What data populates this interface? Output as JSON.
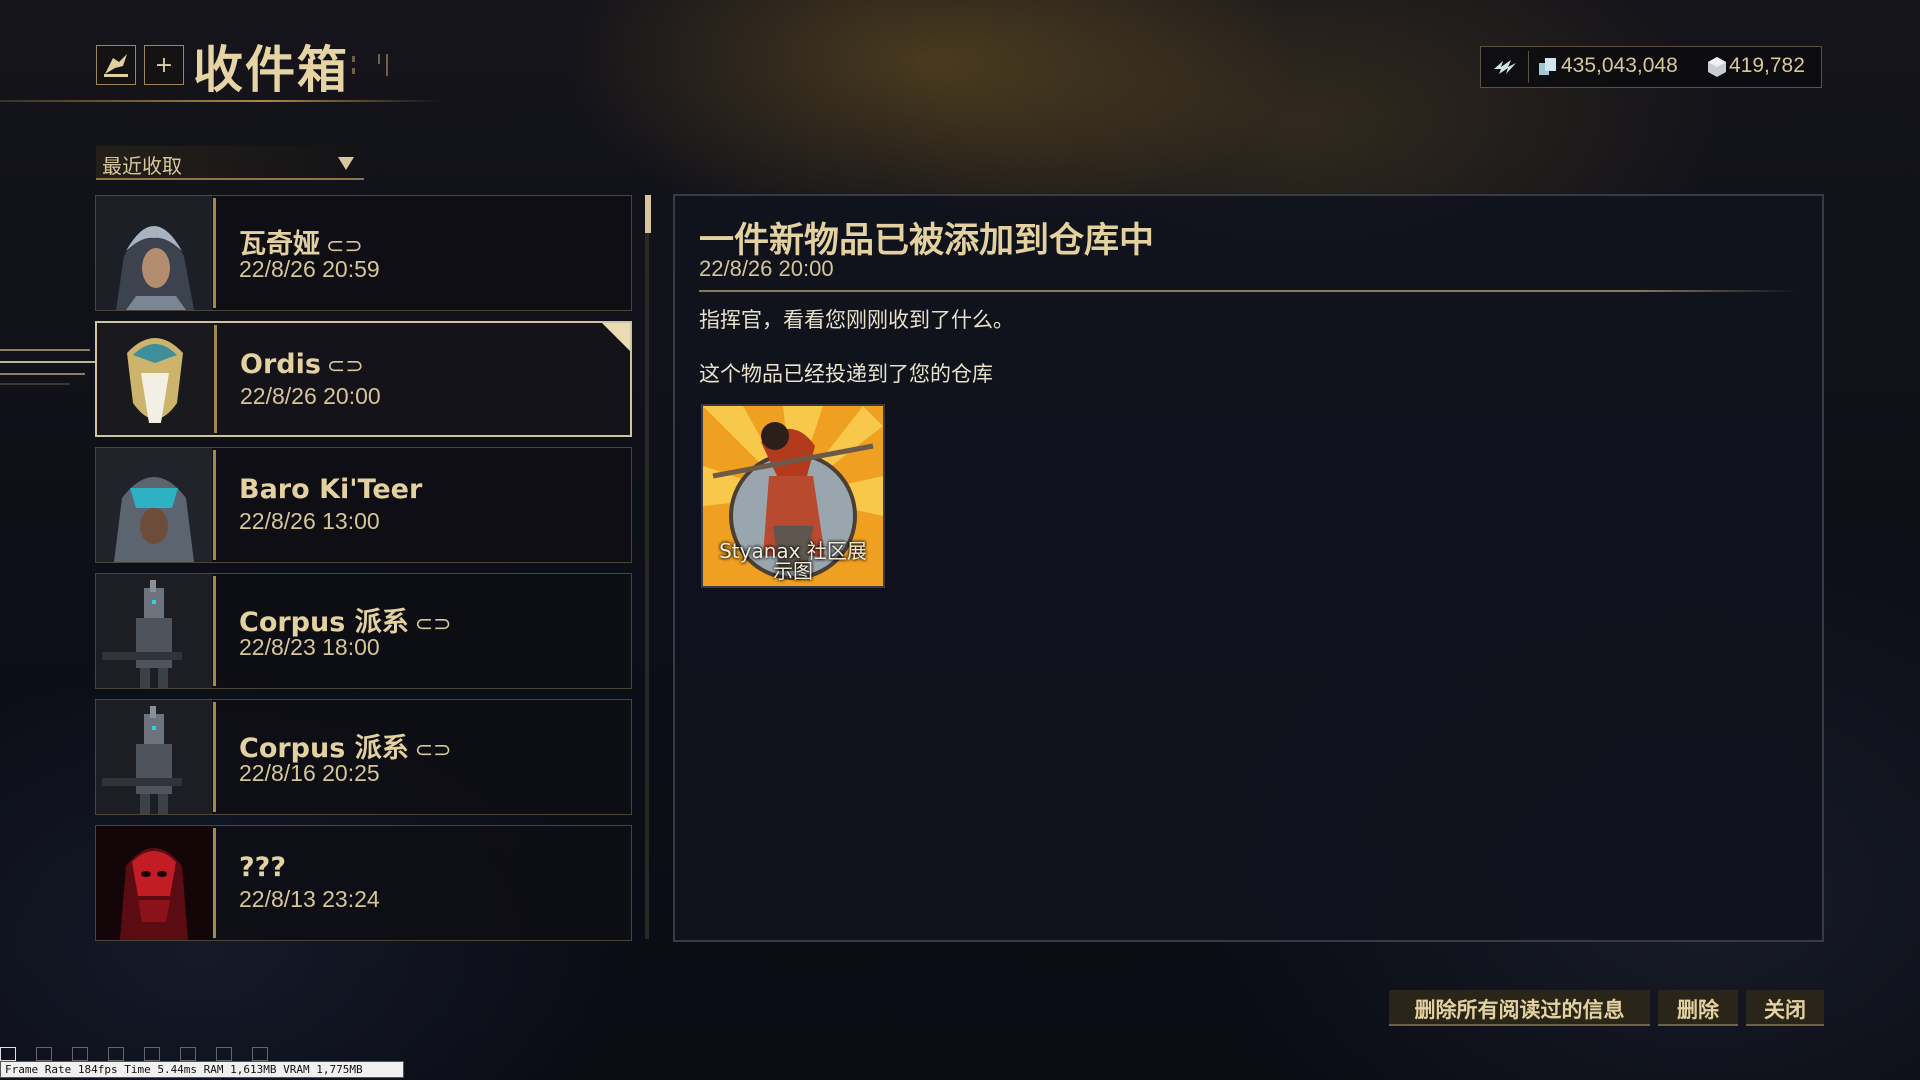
{
  "header": {
    "title": "收件箱",
    "add_label": "+"
  },
  "currency": {
    "credits": "435,043,048",
    "platinum": "419,782"
  },
  "sort": {
    "selected": "最近收取"
  },
  "inbox": [
    {
      "sender": "瓦奇娅",
      "date": "22/8/26 20:59",
      "attachment": true,
      "avatar": "vaykor-icon"
    },
    {
      "sender": "Ordis",
      "date": "22/8/26 20:00",
      "attachment": true,
      "avatar": "ordis-icon"
    },
    {
      "sender": "Baro Ki'Teer",
      "date": "22/8/26 13:00",
      "attachment": false,
      "avatar": "baro-icon"
    },
    {
      "sender": "Corpus 派系",
      "date": "22/8/23 18:00",
      "attachment": true,
      "avatar": "corpus-soldier-icon"
    },
    {
      "sender": "Corpus 派系",
      "date": "22/8/16 20:25",
      "attachment": true,
      "avatar": "corpus-soldier-icon"
    },
    {
      "sender": "???",
      "date": "22/8/13 23:24",
      "attachment": false,
      "avatar": "stalker-icon"
    }
  ],
  "message": {
    "title": "一件新物品已被添加到仓库中",
    "date": "22/8/26 20:00",
    "line1": "指挥官，看看您刚刚收到了什么。",
    "line2": "这个物品已经投递到了您的仓库",
    "attachment_label_1": "Styanax 社区展",
    "attachment_label_2": "示图"
  },
  "buttons": {
    "delete_read": "删除所有阅读过的信息",
    "delete": "删除",
    "close": "关闭"
  },
  "debug": {
    "text": "Frame Rate 184fps Time 5.44ms RAM 1,613MB VRAM 1,775MB"
  },
  "colors": {
    "accent_gold": "#d8c79c",
    "panel_bg": "#10121c",
    "border": "#4a4536"
  }
}
